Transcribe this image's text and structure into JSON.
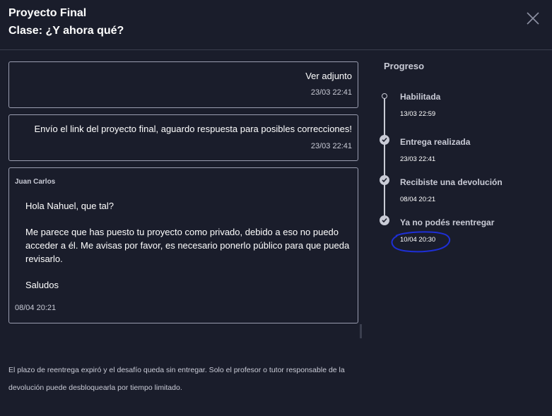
{
  "header": {
    "title": "Proyecto Final",
    "subtitle": "Clase: ¿Y ahora qué?"
  },
  "messages": [
    {
      "text": "Ver adjunto",
      "time": "23/03 22:41"
    },
    {
      "text": "Envío el link del proyecto final, aguardo respuesta para posibles correcciones!",
      "time": "23/03 22:41"
    }
  ],
  "reply": {
    "author": "Juan Carlos",
    "paragraphs": [
      "Hola Nahuel, que tal?",
      "Me parece que has puesto tu proyecto como privado, debido a eso no puedo acceder a él. Me avisas por favor, es necesario ponerlo público para que pueda revisarlo.",
      "Saludos"
    ],
    "time": "08/04 20:21"
  },
  "notice": "El plazo de reentrega expiró y el desafío queda sin entregar. Solo el profesor o tutor responsable de la devolución puede desbloquearla por tiempo limitado.",
  "progress": {
    "title": "Progreso",
    "steps": [
      {
        "label": "Habilitada",
        "time": "13/03 22:59"
      },
      {
        "label": "Entrega realizada",
        "time": "23/03 22:41"
      },
      {
        "label": "Recibiste una devolución",
        "time": "08/04 20:21"
      },
      {
        "label": "Ya no podés reentregar",
        "time": "10/04 20:30"
      }
    ]
  },
  "colors": {
    "background": "#1a1d2b",
    "border": "#9a9db0",
    "annotation": "#1e2fd6"
  },
  "icons": [
    "close-icon",
    "check-icon"
  ]
}
